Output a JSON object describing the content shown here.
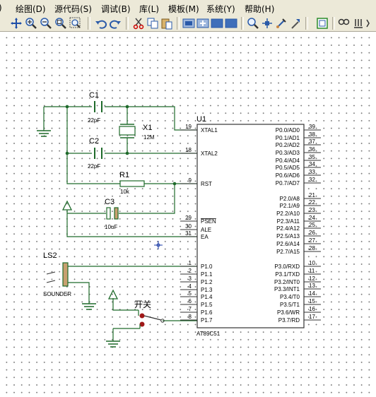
{
  "menu": [
    {
      "label": "绘图(D)"
    },
    {
      "label": "源代码(S)"
    },
    {
      "label": "调试(B)"
    },
    {
      "label": "库(L)"
    },
    {
      "label": "模板(M)"
    },
    {
      "label": "系统(Y)"
    },
    {
      "label": "帮助(H)"
    }
  ],
  "toolbar_icons": [
    "crosshair",
    "zoom-in",
    "zoom-out",
    "zoom-all",
    "zoom-area",
    "undo",
    "redo",
    "cut",
    "copy",
    "paste",
    "block-copy",
    "block-move",
    "block-rotate",
    "block-delete",
    "pick-device",
    "make-device",
    "packaging-tool",
    "decompose",
    "wire-autorouter",
    "search",
    "property-assignment"
  ],
  "schematic": {
    "u1": {
      "ref": "U1",
      "part": "AT89C51",
      "left_pins": [
        {
          "no": "19",
          "name": "XTAL1"
        },
        {
          "no": "18",
          "name": "XTAL2"
        },
        {
          "no": "9",
          "name": "RST"
        },
        {
          "no": "29",
          "name": "PSEN"
        },
        {
          "no": "30",
          "name": "ALE"
        },
        {
          "no": "31",
          "name": "EA"
        },
        {
          "no": "1",
          "name": "P1.0"
        },
        {
          "no": "2",
          "name": "P1.1"
        },
        {
          "no": "3",
          "name": "P1.2"
        },
        {
          "no": "4",
          "name": "P1.3"
        },
        {
          "no": "5",
          "name": "P1.4"
        },
        {
          "no": "6",
          "name": "P1.5"
        },
        {
          "no": "7",
          "name": "P1.6"
        },
        {
          "no": "8",
          "name": "P1.7"
        }
      ],
      "right_pins": [
        {
          "no": "39",
          "name": "P0.0/AD0"
        },
        {
          "no": "38",
          "name": "P0.1/AD1"
        },
        {
          "no": "37",
          "name": "P0.2/AD2"
        },
        {
          "no": "36",
          "name": "P0.3/AD3"
        },
        {
          "no": "35",
          "name": "P0.4/AD4"
        },
        {
          "no": "34",
          "name": "P0.5/AD5"
        },
        {
          "no": "33",
          "name": "P0.6/AD6"
        },
        {
          "no": "32",
          "name": "P0.7/AD7"
        },
        {
          "no": "21",
          "name": "P2.0/A8"
        },
        {
          "no": "22",
          "name": "P2.1/A9"
        },
        {
          "no": "23",
          "name": "P2.2/A10"
        },
        {
          "no": "24",
          "name": "P2.3/A11"
        },
        {
          "no": "25",
          "name": "P2.4/A12"
        },
        {
          "no": "26",
          "name": "P2.5/A13"
        },
        {
          "no": "27",
          "name": "P2.6/A14"
        },
        {
          "no": "28",
          "name": "P2.7/A15"
        },
        {
          "no": "10",
          "name": "P3.0/RXD"
        },
        {
          "no": "11",
          "name": "P3.1/TXD"
        },
        {
          "no": "12",
          "name": "P3.2/INT0"
        },
        {
          "no": "13",
          "name": "P3.3/INT1"
        },
        {
          "no": "14",
          "name": "P3.4/T0"
        },
        {
          "no": "15",
          "name": "P3.5/T1"
        },
        {
          "no": "16",
          "name": "P3.6/WR"
        },
        {
          "no": "17",
          "name": "P3.7/RD"
        }
      ]
    },
    "c1": {
      "ref": "C1",
      "value": "22pF"
    },
    "c2": {
      "ref": "C2",
      "value": "22pF"
    },
    "x1": {
      "ref": "X1",
      "value": "12M"
    },
    "r1": {
      "ref": "R1",
      "value": "10k"
    },
    "c3": {
      "ref": "C3",
      "value": "10uF"
    },
    "ls2": {
      "ref": "LS2",
      "value": "SOUNDER"
    },
    "switch": {
      "label": "开关"
    }
  }
}
